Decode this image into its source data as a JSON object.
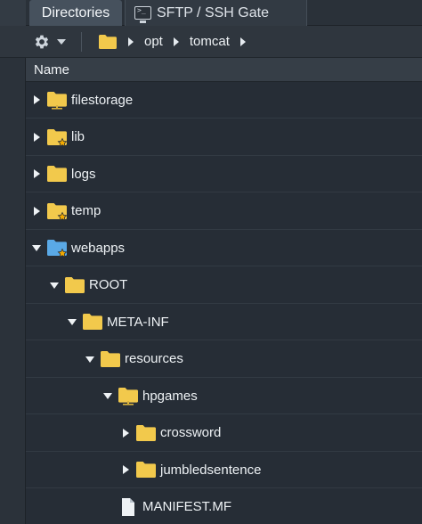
{
  "tabs": [
    {
      "label": "Directories",
      "active": true
    },
    {
      "label": "SFTP / SSH Gate",
      "active": false
    }
  ],
  "toolbar": {
    "breadcrumb": [
      "opt",
      "tomcat"
    ]
  },
  "column_header": "Name",
  "colors": {
    "folder_yellow": "#f2c94c",
    "folder_blue": "#5aa9e6",
    "star": "#f2a900",
    "background": "#262d36"
  },
  "tree": [
    {
      "name": "filestorage",
      "level": 0,
      "expander": "collapsed",
      "icon": "folder-shared-icon"
    },
    {
      "name": "lib",
      "level": 0,
      "expander": "collapsed",
      "icon": "folder-star-icon"
    },
    {
      "name": "logs",
      "level": 0,
      "expander": "collapsed",
      "icon": "folder-icon"
    },
    {
      "name": "temp",
      "level": 0,
      "expander": "collapsed",
      "icon": "folder-star-icon"
    },
    {
      "name": "webapps",
      "level": 0,
      "expander": "expanded",
      "icon": "folder-blue-star-icon"
    },
    {
      "name": "ROOT",
      "level": 1,
      "expander": "expanded",
      "icon": "folder-icon"
    },
    {
      "name": "META-INF",
      "level": 2,
      "expander": "expanded",
      "icon": "folder-icon"
    },
    {
      "name": "resources",
      "level": 3,
      "expander": "expanded",
      "icon": "folder-icon"
    },
    {
      "name": "hpgames",
      "level": 4,
      "expander": "expanded",
      "icon": "folder-shared-icon"
    },
    {
      "name": "crossword",
      "level": 5,
      "expander": "collapsed",
      "icon": "folder-icon"
    },
    {
      "name": "jumbledsentence",
      "level": 5,
      "expander": "collapsed",
      "icon": "folder-icon"
    },
    {
      "name": "MANIFEST.MF",
      "level": 4,
      "expander": "none",
      "icon": "file-icon"
    }
  ]
}
